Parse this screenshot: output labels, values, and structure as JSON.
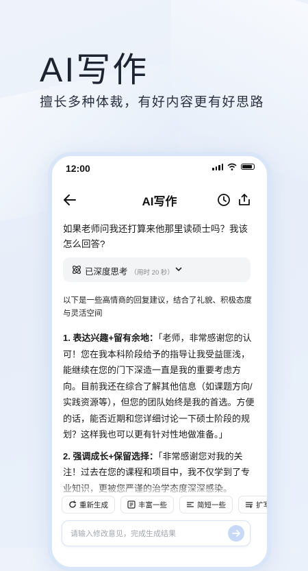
{
  "hero": {
    "title": "AI写作",
    "subtitle": "擅长多种体裁，有好内容更有好思路"
  },
  "status_bar": {
    "time": "12:00"
  },
  "nav": {
    "title": "AI写作",
    "icons": [
      "back-arrow-icon",
      "history-clock-icon",
      "export-icon"
    ]
  },
  "question": "如果老师问我还打算来他那里读硕士吗？我该怎么回答?",
  "thinking": {
    "label": "已深度思考",
    "time": "（用时 20 秒）"
  },
  "answer": {
    "intro": "以下是一些高情商的回复建议，结合了礼貌、积极态度与灵活空间",
    "points": [
      {
        "heading": "1. 表达兴趣+留有余地：",
        "text": "「老师，非常感谢您的认可！您在我本科阶段给予的指导让我受益匪浅，能继续在您的门下深造一直是我的重要考虑方向。目前我还在综合了解其他信息（如课题方向/实践资源等），但您的团队始终是我的首选。方便的话，能否近期和您详细讨论一下硕士阶段的规划？这样我也可以更有针对性地做准备。」"
      },
      {
        "heading": "2. 强调成长+保留选择：",
        "text": "「非常感谢您对我的关注！过去在您的课程和项目中，我不仅学到了专业知识，更被您严谨的治学态度深深感染。"
      }
    ]
  },
  "actions": [
    {
      "label": "重新生成",
      "icon": "regenerate-icon"
    },
    {
      "label": "丰富一些",
      "icon": "enrich-icon"
    },
    {
      "label": "简短一些",
      "icon": "shorten-icon"
    },
    {
      "label": "扩写缩写",
      "icon": "expand-icon"
    }
  ],
  "input": {
    "placeholder": "请输入修改意见，完成生成结果"
  },
  "colors": {
    "accent": "#c7d9f6",
    "background": "#eaf1fb",
    "text": "#1a1a1a"
  }
}
